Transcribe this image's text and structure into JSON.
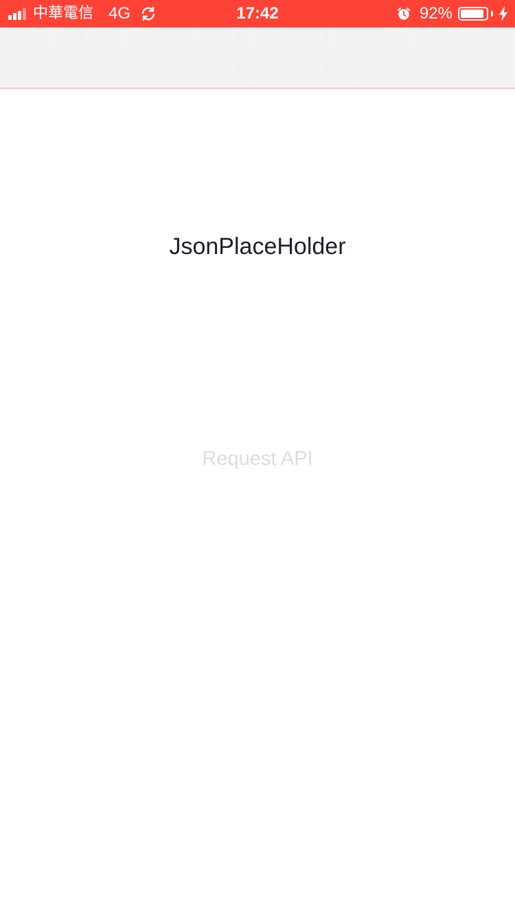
{
  "status_bar": {
    "carrier": "中華電信",
    "network": "4G",
    "time": "17:42",
    "battery_percent": "92%",
    "battery_level": 0.92,
    "background_color": "#fe4236",
    "icons": [
      "signal-icon",
      "sync-icon",
      "alarm-icon",
      "battery-icon",
      "charging-bolt-icon"
    ]
  },
  "main": {
    "title": "JsonPlaceHolder",
    "request_button_label": "Request API",
    "request_button_color": "#dcdedc"
  }
}
